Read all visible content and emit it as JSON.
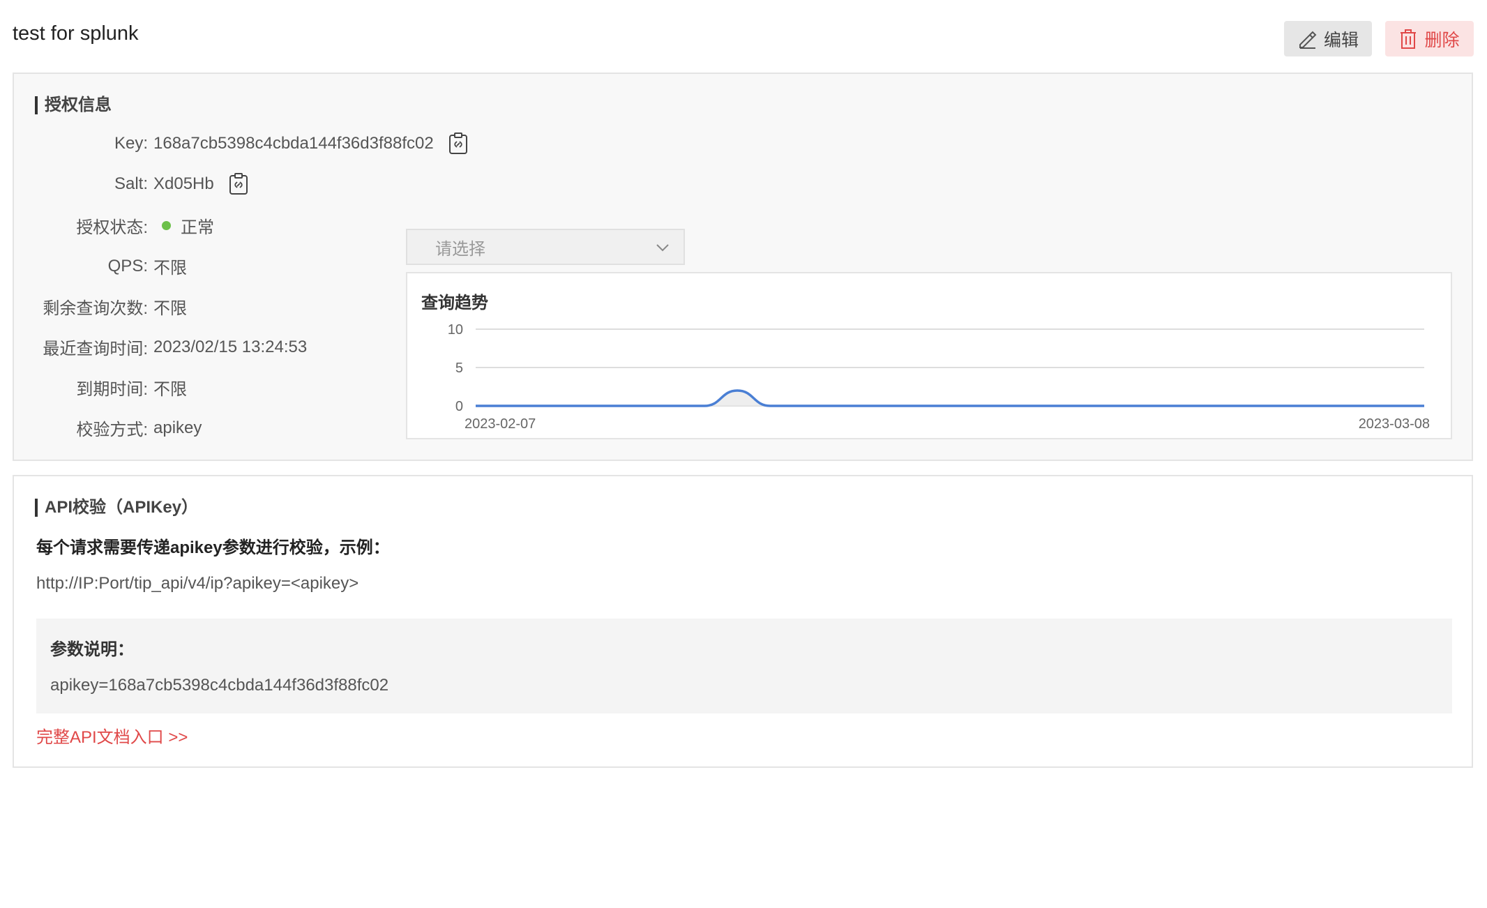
{
  "header": {
    "title": "test for splunk",
    "edit_label": "编辑",
    "delete_label": "删除"
  },
  "auth_info": {
    "section_title": "授权信息",
    "key_label": "Key:",
    "key_value": "168a7cb5398c4cbda144f36d3f88fc02",
    "salt_label": "Salt:",
    "salt_value": "Xd05Hb",
    "status_label": "授权状态:",
    "status_value": "正常",
    "status_color": "#6cc04a",
    "qps_label": "QPS:",
    "qps_value": "不限",
    "remaining_label": "剩余查询次数:",
    "remaining_value": "不限",
    "last_query_label": "最近查询时间:",
    "last_query_value": "2023/02/15 13:24:53",
    "expire_label": "到期时间:",
    "expire_value": "不限",
    "verify_label": "校验方式:",
    "verify_value": "apikey",
    "select_placeholder": "请选择",
    "icons": [
      "copy-icon",
      "chevron-down-icon",
      "edit-icon",
      "trash-icon"
    ]
  },
  "chart_data": {
    "type": "area",
    "title": "查询趋势",
    "x_range": [
      "2023-02-07",
      "2023-03-08"
    ],
    "x_tick_labels": [
      "2023-02-07",
      "2023-03-08"
    ],
    "y_ticks": [
      0,
      5,
      10
    ],
    "ylim": [
      0,
      10
    ],
    "grid": true,
    "series_color": "#4a7fd4",
    "x": [
      "2023-02-07",
      "2023-02-08",
      "2023-02-09",
      "2023-02-10",
      "2023-02-11",
      "2023-02-12",
      "2023-02-13",
      "2023-02-14",
      "2023-02-15",
      "2023-02-16",
      "2023-02-17",
      "2023-02-18",
      "2023-02-19",
      "2023-02-20",
      "2023-02-21",
      "2023-02-22",
      "2023-02-23",
      "2023-02-24",
      "2023-02-25",
      "2023-02-26",
      "2023-02-27",
      "2023-02-28",
      "2023-03-01",
      "2023-03-02",
      "2023-03-03",
      "2023-03-04",
      "2023-03-05",
      "2023-03-06",
      "2023-03-07",
      "2023-03-08"
    ],
    "values": [
      0,
      0,
      0,
      0,
      0,
      0,
      0,
      0,
      2,
      0,
      0,
      0,
      0,
      0,
      0,
      0,
      0,
      0,
      0,
      0,
      0,
      0,
      0,
      0,
      0,
      0,
      0,
      0,
      0,
      0
    ]
  },
  "api": {
    "section_title": "API校验（APIKey）",
    "description": "每个请求需要传递apikey参数进行校验，示例：",
    "url_example": "http://IP:Port/tip_api/v4/ip?apikey=<apikey>",
    "param_title": "参数说明：",
    "param_value": "apikey=168a7cb5398c4cbda144f36d3f88fc02",
    "doc_link": "完整API文档入口 >>",
    "link_color": "#e04848"
  }
}
